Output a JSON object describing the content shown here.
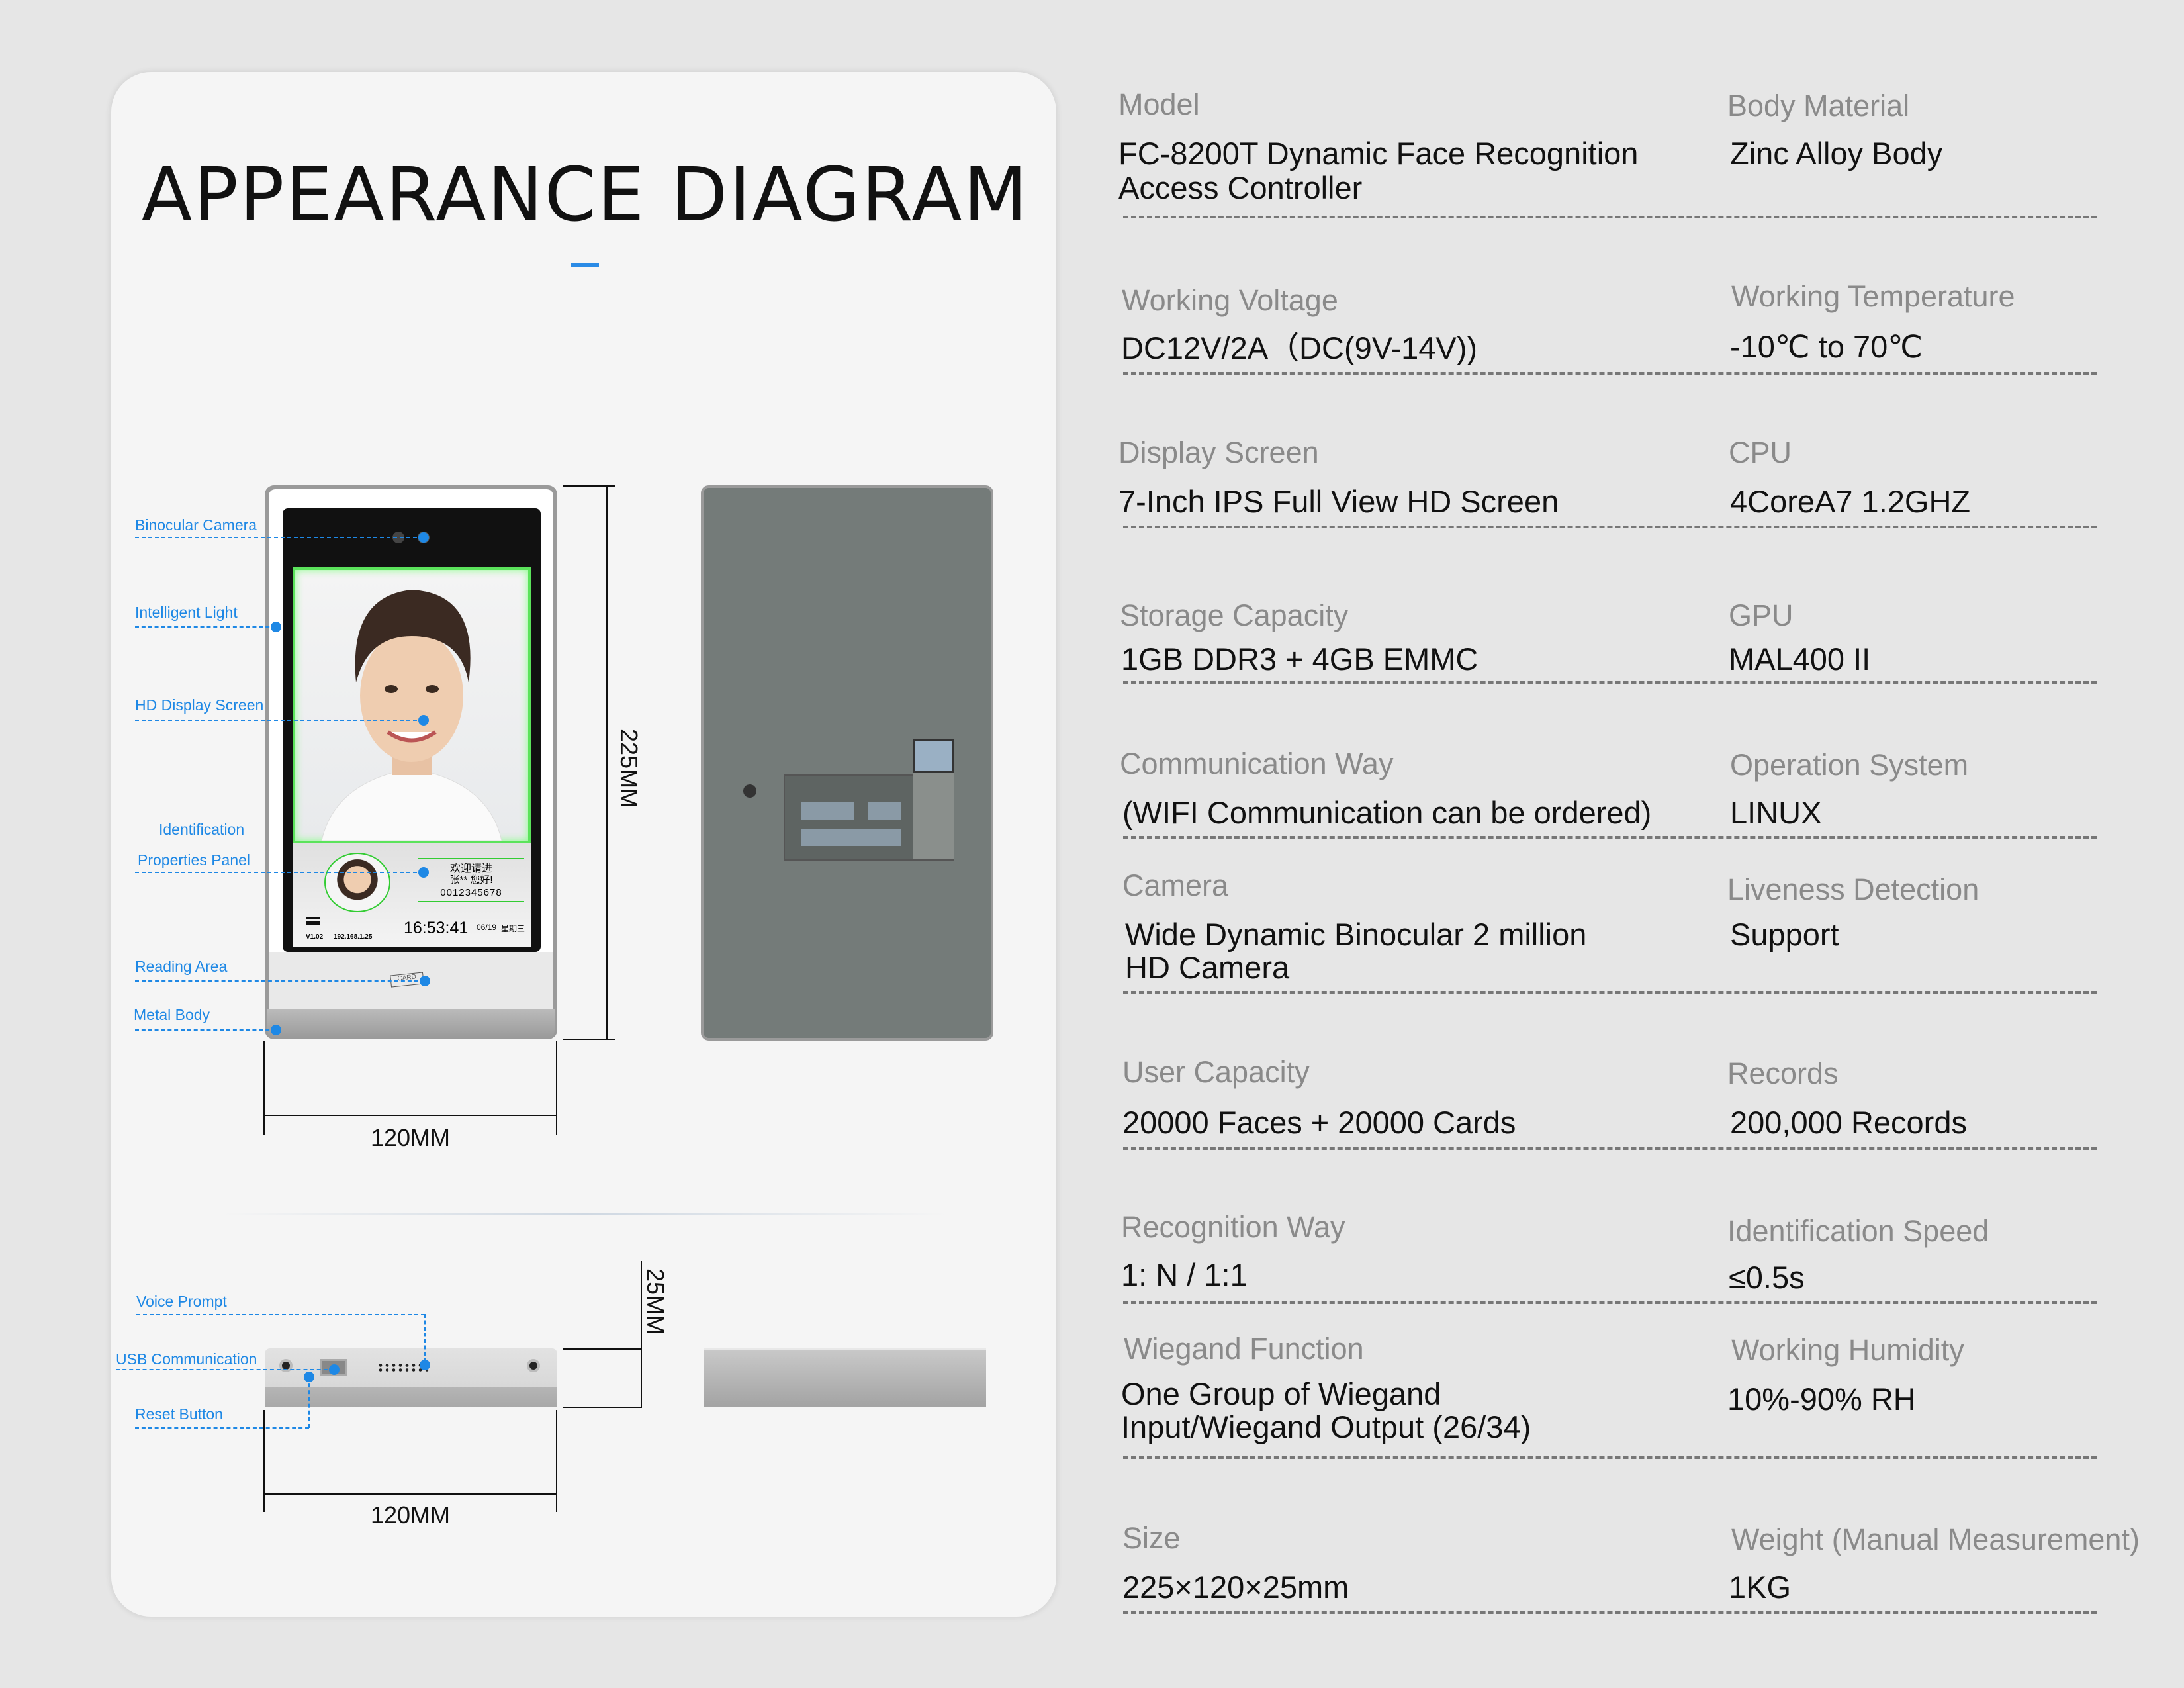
{
  "diagram": {
    "title": "APPEARANCE DIAGRAM",
    "accent": "#1e88e5",
    "front_labels": {
      "binocular_camera": "Binocular Camera",
      "intelligent_light": "Intelligent Light",
      "hd_display": "HD Display Screen",
      "identification_1": "Identification",
      "identification_2": "Properties Panel",
      "reading_area": "Reading Area",
      "metal_body": "Metal Body"
    },
    "bottom_labels": {
      "voice_prompt": "Voice Prompt",
      "usb": "USB Communication",
      "reset": "Reset Button"
    },
    "dimensions": {
      "height": "225MM",
      "width_front": "120MM",
      "depth": "25MM",
      "width_bottom": "120MM"
    },
    "screen": {
      "welcome": "欢迎请进",
      "greeting": "张** 您好!",
      "id_number": "0012345678",
      "time": "16:53:41",
      "date": "06/19",
      "weekday": "星期三",
      "version": "V1.02",
      "ip": "192.168.1.25",
      "card_label": "CARD"
    }
  },
  "specs": [
    {
      "left": {
        "label": "Model",
        "value": [
          "FC-8200T Dynamic Face Recognition",
          "Access Controller"
        ]
      },
      "right": {
        "label": "Body Material",
        "value": [
          "Zinc Alloy Body"
        ]
      }
    },
    {
      "left": {
        "label": "Working Voltage",
        "value": [
          "DC12V/2A（DC(9V-14V))"
        ]
      },
      "right": {
        "label": "Working Temperature",
        "value": [
          "-10℃ to 70℃"
        ]
      }
    },
    {
      "left": {
        "label": "Display Screen",
        "value": [
          "7-Inch IPS Full View HD Screen"
        ]
      },
      "right": {
        "label": "CPU",
        "value": [
          "4CoreA7  1.2GHZ"
        ]
      }
    },
    {
      "left": {
        "label": "Storage Capacity",
        "value": [
          "1GB DDR3 + 4GB EMMC"
        ]
      },
      "right": {
        "label": "GPU",
        "value": [
          "MAL400 II"
        ]
      }
    },
    {
      "left": {
        "label": "Communication Way",
        "value": [
          "(WIFI Communication can be ordered)"
        ]
      },
      "right": {
        "label": "Operation System",
        "value": [
          "LINUX"
        ]
      }
    },
    {
      "left": {
        "label": "Camera",
        "value": [
          "Wide Dynamic Binocular 2 million",
          "HD Camera"
        ]
      },
      "right": {
        "label": "Liveness Detection",
        "value": [
          "Support"
        ]
      }
    },
    {
      "left": {
        "label": "User Capacity",
        "value": [
          "20000 Faces + 20000 Cards"
        ]
      },
      "right": {
        "label": "Records",
        "value": [
          "200,000 Records"
        ]
      }
    },
    {
      "left": {
        "label": "Recognition Way",
        "value": [
          "1:  N / 1:1"
        ]
      },
      "right": {
        "label": "Identification Speed",
        "value": [
          "≤0.5s"
        ]
      }
    },
    {
      "left": {
        "label": "Wiegand Function",
        "value": [
          "One Group of Wiegand",
          "Input/Wiegand Output (26/34)"
        ]
      },
      "right": {
        "label": "Working Humidity",
        "value": [
          "10%-90% RH"
        ]
      }
    },
    {
      "left": {
        "label": "Size",
        "value": [
          "225×120×25mm"
        ]
      },
      "right": {
        "label": "Weight (Manual Measurement)",
        "value": [
          "1KG"
        ]
      }
    }
  ]
}
